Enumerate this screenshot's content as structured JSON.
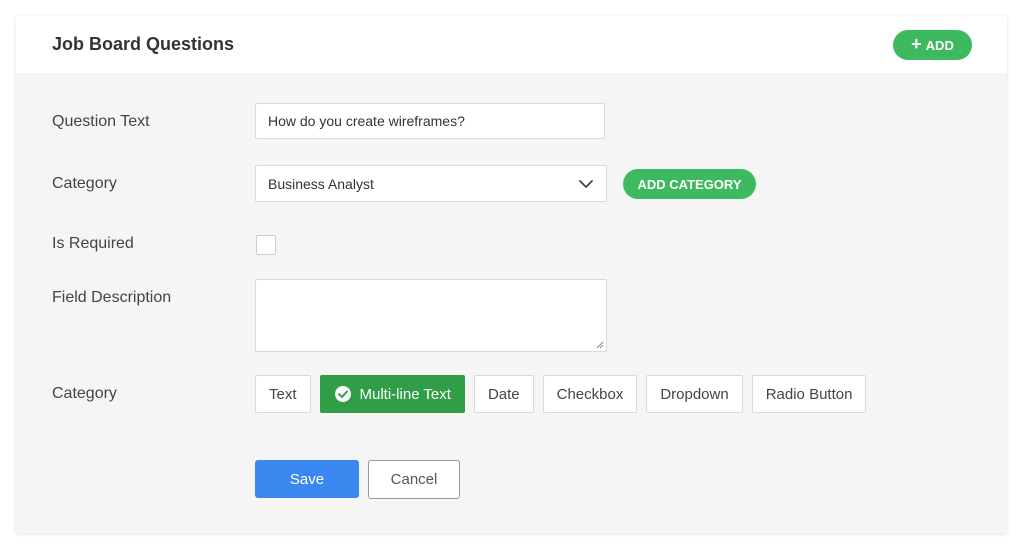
{
  "header": {
    "title": "Job Board Questions",
    "add_label": "ADD"
  },
  "form": {
    "question_text": {
      "label": "Question Text",
      "value": "How do you create wireframes?"
    },
    "category": {
      "label": "Category",
      "selected": "Business Analyst",
      "add_category_label": "ADD CATEGORY"
    },
    "is_required": {
      "label": "Is Required",
      "checked": false
    },
    "field_description": {
      "label": "Field Description",
      "value": ""
    },
    "field_type": {
      "label": "Category",
      "options": [
        "Text",
        "Multi-line Text",
        "Date",
        "Checkbox",
        "Dropdown",
        "Radio Button"
      ],
      "selected": "Multi-line Text"
    },
    "actions": {
      "save_label": "Save",
      "cancel_label": "Cancel"
    }
  },
  "colors": {
    "accent_green": "#3dba5f",
    "active_green": "#2f9e46",
    "primary_blue": "#3b87f0"
  },
  "icons": {
    "add": "plus-icon",
    "dropdown": "chevron-down-icon",
    "selected_option": "check-circle-icon",
    "textarea_resize": "resize-grip-icon"
  }
}
